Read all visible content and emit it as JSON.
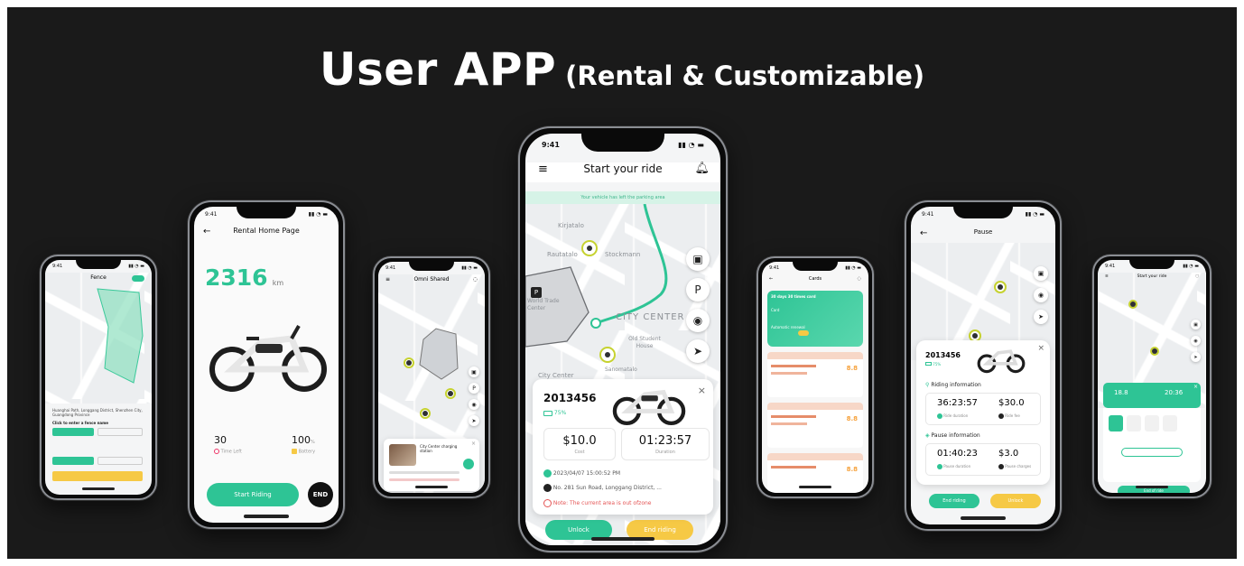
{
  "header": {
    "title": "User APP",
    "subtitle": "(Rental & Customizable)"
  },
  "colors": {
    "accent_green": "#2ec495",
    "accent_yellow": "#f6c945",
    "background": "#1a1a1a"
  },
  "status_time": "9:41",
  "phone1": {
    "title": "Fence",
    "address": "Huanghai Path, Longgang District, Shenzhen City, Guangdong Province",
    "hint": "Click to enter a fence name"
  },
  "phone2": {
    "title": "Rental Home Page",
    "odometer": "2316",
    "odometer_unit": "km",
    "time_value": "30",
    "time_label": "Time Left",
    "battery_value": "100",
    "battery_unit": "%",
    "battery_label": "Battery",
    "start_button": "Start Riding",
    "end_button": "END"
  },
  "phone3": {
    "title": "Omni Shared",
    "station_title": "City Center charging station"
  },
  "phone4": {
    "title": "Start your ride",
    "banner": "Your vehicle has left the parking area",
    "map_labels": [
      "Kirjatalo",
      "Rautatalo",
      "Stockmann",
      "World Trade Center",
      "CITY CENTER",
      "Old Student House",
      "City Center",
      "Sanomatalo"
    ],
    "vehicle_id": "2013456",
    "battery": "75%",
    "cost_value": "$10.0",
    "cost_label": "Cost",
    "duration_value": "01:23:57",
    "duration_label": "Duration",
    "datetime": "2023/04/07 15:00:52 PM",
    "address": "No. 281 Sun Road, Longgang District, ...",
    "warning": "Note: The current area is out ofzone",
    "unlock_button": "Unlock",
    "end_button": "End riding"
  },
  "phone5": {
    "title": "Cards",
    "card_lines": [
      "30 days 30 times card",
      "Card",
      "Automatic renewal"
    ],
    "list_values": [
      "8.8",
      "8.8",
      "8.8"
    ]
  },
  "phone6": {
    "title": "Pause",
    "vehicle_id": "2013456",
    "battery": "75%",
    "riding_section": "Riding information",
    "ride_duration_value": "36:23:57",
    "ride_duration_label": "Ride duration",
    "ride_fee_value": "$30.0",
    "ride_fee_label": "Ride fee",
    "pause_section": "Pause information",
    "pause_duration_value": "01:40:23",
    "pause_duration_label": "Pause duration",
    "pause_fee_value": "$3.0",
    "pause_fee_label": "Pause charges",
    "end_button": "End riding",
    "unlock_button": "Unlock"
  },
  "phone7": {
    "title": "Start your ride",
    "distance_value": "18.8",
    "time_value": "20:36",
    "end_button": "End of ride"
  }
}
